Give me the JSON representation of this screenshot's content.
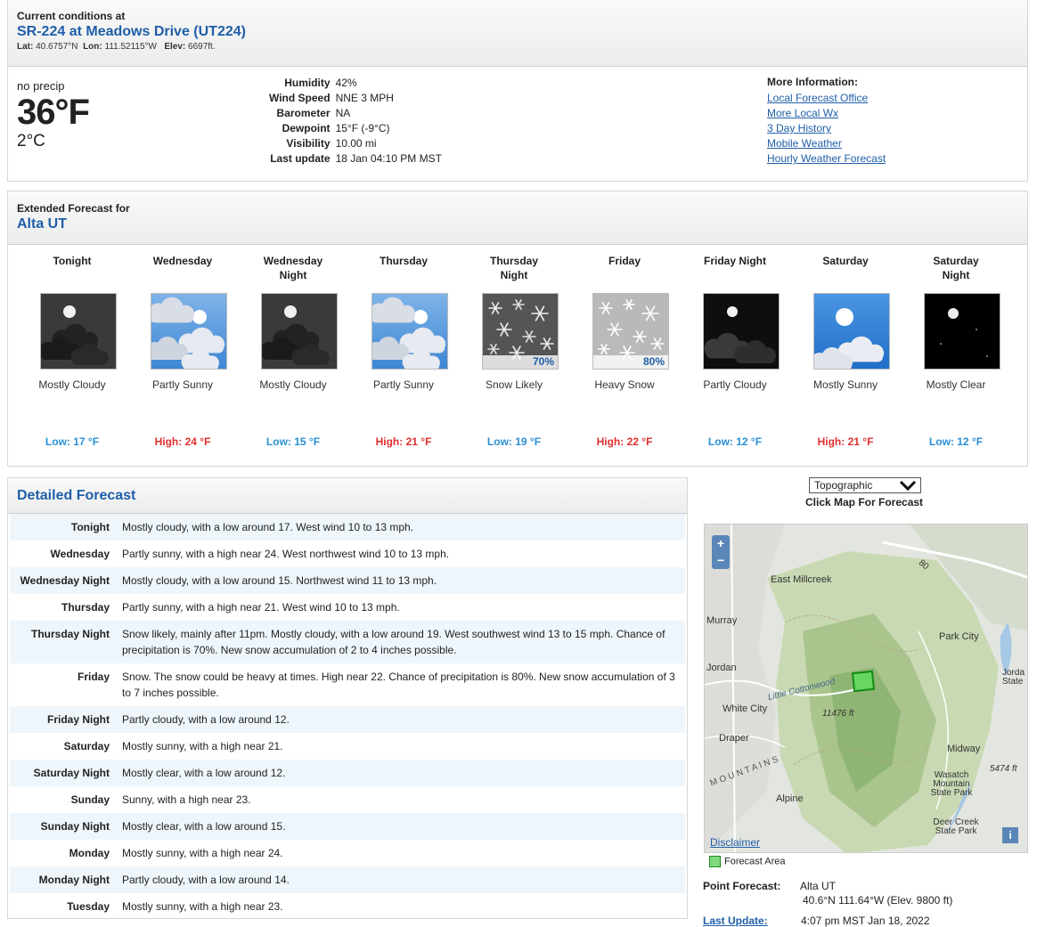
{
  "current": {
    "header_small": "Current conditions at",
    "station": "SR-224 at Meadows Drive (UT224)",
    "lat_label": "Lat:",
    "lat": "40.6757°N",
    "lon_label": "Lon:",
    "lon": "111.52115°W",
    "elev_label": "Elev:",
    "elev": "6697ft.",
    "precip": "no precip",
    "temp_f": "36°F",
    "temp_c": "2°C",
    "details": [
      {
        "label": "Humidity",
        "value": "42%"
      },
      {
        "label": "Wind Speed",
        "value": "NNE 3 MPH"
      },
      {
        "label": "Barometer",
        "value": "NA"
      },
      {
        "label": "Dewpoint",
        "value": "15°F (-9°C)"
      },
      {
        "label": "Visibility",
        "value": "10.00 mi"
      },
      {
        "label": "Last update",
        "value": "18 Jan 04:10 PM MST"
      }
    ],
    "more_info_title": "More Information:",
    "links": [
      "Local Forecast Office",
      "More Local Wx",
      "3 Day History",
      "Mobile Weather",
      "Hourly Weather Forecast"
    ]
  },
  "extended": {
    "header_small": "Extended Forecast for",
    "location": "Alta UT",
    "periods": [
      {
        "name": "Tonight",
        "short": "Mostly Cloudy",
        "temp": "Low: 17 °F",
        "kind": "low",
        "icon": "night-cloudy-icon",
        "pop": ""
      },
      {
        "name": "Wednesday",
        "short": "Partly Sunny",
        "temp": "High: 24 °F",
        "kind": "high",
        "icon": "partly-sunny-icon",
        "pop": ""
      },
      {
        "name": "Wednesday Night",
        "short": "Mostly Cloudy",
        "temp": "Low: 15 °F",
        "kind": "low",
        "icon": "night-cloudy-icon",
        "pop": ""
      },
      {
        "name": "Thursday",
        "short": "Partly Sunny",
        "temp": "High: 21 °F",
        "kind": "high",
        "icon": "partly-sunny-icon",
        "pop": ""
      },
      {
        "name": "Thursday Night",
        "short": "Snow Likely",
        "temp": "Low: 19 °F",
        "kind": "low",
        "icon": "snow-night-icon",
        "pop": "70%"
      },
      {
        "name": "Friday",
        "short": "Heavy Snow",
        "temp": "High: 22 °F",
        "kind": "high",
        "icon": "heavy-snow-icon",
        "pop": "80%"
      },
      {
        "name": "Friday Night",
        "short": "Partly Cloudy",
        "temp": "Low: 12 °F",
        "kind": "low",
        "icon": "night-partly-cloudy-icon",
        "pop": ""
      },
      {
        "name": "Saturday",
        "short": "Mostly Sunny",
        "temp": "High: 21 °F",
        "kind": "high",
        "icon": "mostly-sunny-icon",
        "pop": ""
      },
      {
        "name": "Saturday Night",
        "short": "Mostly Clear",
        "temp": "Low: 12 °F",
        "kind": "low",
        "icon": "night-clear-icon",
        "pop": ""
      }
    ]
  },
  "detailed": {
    "title": "Detailed Forecast",
    "rows": [
      {
        "period": "Tonight",
        "text": "Mostly cloudy, with a low around 17. West wind 10 to 13 mph."
      },
      {
        "period": "Wednesday",
        "text": "Partly sunny, with a high near 24. West northwest wind 10 to 13 mph."
      },
      {
        "period": "Wednesday Night",
        "text": "Mostly cloudy, with a low around 15. Northwest wind 11 to 13 mph."
      },
      {
        "period": "Thursday",
        "text": "Partly sunny, with a high near 21. West wind 10 to 13 mph."
      },
      {
        "period": "Thursday Night",
        "text": "Snow likely, mainly after 11pm. Mostly cloudy, with a low around 19. West southwest wind 13 to 15 mph. Chance of precipitation is 70%. New snow accumulation of 2 to 4 inches possible."
      },
      {
        "period": "Friday",
        "text": "Snow. The snow could be heavy at times. High near 22. Chance of precipitation is 80%. New snow accumulation of 3 to 7 inches possible."
      },
      {
        "period": "Friday Night",
        "text": "Partly cloudy, with a low around 12."
      },
      {
        "period": "Saturday",
        "text": "Mostly sunny, with a high near 21."
      },
      {
        "period": "Saturday Night",
        "text": "Mostly clear, with a low around 12."
      },
      {
        "period": "Sunday",
        "text": "Sunny, with a high near 23."
      },
      {
        "period": "Sunday Night",
        "text": "Mostly clear, with a low around 15."
      },
      {
        "period": "Monday",
        "text": "Mostly sunny, with a high near 24."
      },
      {
        "period": "Monday Night",
        "text": "Partly cloudy, with a low around 14."
      },
      {
        "period": "Tuesday",
        "text": "Mostly sunny, with a high near 23."
      }
    ]
  },
  "map": {
    "layer_select": "Topographic",
    "caption": "Click Map For Forecast",
    "zoom_in": "+",
    "zoom_out": "−",
    "labels": [
      "East Millcreek",
      "Murray",
      "Park City",
      "Jordan",
      "White City",
      "11476 ft",
      "Draper",
      "Midway",
      "Alpine",
      "Wasatch Mountain State Park",
      "5474 ft",
      "Deer Creek State Park",
      "Little Cottonwood",
      "M O U N T A I N S",
      "80",
      "Jorda State"
    ],
    "disclaimer": "Disclaimer",
    "info": "i",
    "forecast_area": "Forecast Area"
  },
  "point_forecast": {
    "label": "Point Forecast:",
    "location": "Alta UT",
    "coords": "40.6°N 111.64°W (Elev. 9800 ft)"
  },
  "last_update": {
    "label": "Last Update:",
    "value": "4:07 pm MST Jan 18, 2022"
  },
  "colors": {
    "link_blue": "#1f5fa8",
    "low_blue": "#2a8fd6",
    "high_red": "#e02f2f",
    "row_stripe": "#eef6fc"
  }
}
